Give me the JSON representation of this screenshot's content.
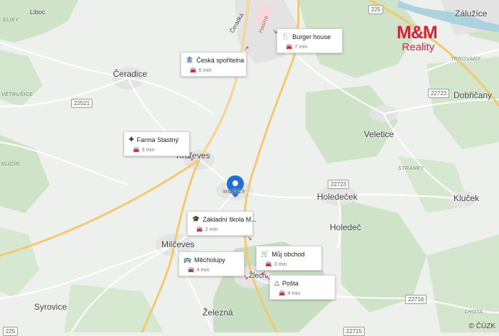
{
  "brand": {
    "logo": "M&M",
    "subtitle": "Reality"
  },
  "copyright": "© ČÚZK",
  "places": {
    "liboc": "Liboc",
    "ceradice": "Čeradice",
    "kralovice": "Kraľeves",
    "milcice": "MILČICE",
    "milceves": "Milčeves",
    "syrovice": "Syrovice",
    "zelezna": "Železná",
    "holedecek": "Holedeček",
    "holedec": "Holedeč",
    "veletice": "Veletice",
    "klucek": "Kluček",
    "dobricany": "Dobřičany",
    "zaluzice": "Záluží­ce",
    "cerada": "Čeradká",
    "hasina": "Hasina",
    "zatec": "Žlech"
  },
  "areas": {
    "vetrusice": "VĚTRUŠICE",
    "klicin": "KLIČÍN",
    "truskavna": "TRNOVANY",
    "stranky": "STRÁNKY",
    "lhota": "LHOTA",
    "kliky": "KLIKY"
  },
  "road_numbers": [
    "225",
    "22521",
    "22723",
    "22723",
    "22716",
    "22715",
    "225"
  ],
  "pois": [
    {
      "id": "burger",
      "icon": "fork-knife-icon",
      "name": "Burger house",
      "time": "7 min"
    },
    {
      "id": "sporitelna",
      "icon": "bank-icon",
      "name": "Česká spořitelna",
      "time": "6 min"
    },
    {
      "id": "farma",
      "icon": "medical-cross-icon",
      "name": "Farma Stastný",
      "time": "3 min"
    },
    {
      "id": "skola",
      "icon": "graduation-cap-icon",
      "name": "Základní škola M...",
      "time": "2 min"
    },
    {
      "id": "obchod",
      "icon": "cart-icon",
      "name": "Můj obchod",
      "time": "3 min"
    },
    {
      "id": "mecholupy",
      "icon": "bus-icon",
      "name": "Měcholupy",
      "time": "4 min"
    },
    {
      "id": "posta",
      "icon": "post-icon",
      "name": "Pošta",
      "time": "4 min"
    }
  ],
  "colors": {
    "brand": "#d4213d",
    "pin": "#1e6fd0",
    "pointer": "#c0243c"
  }
}
